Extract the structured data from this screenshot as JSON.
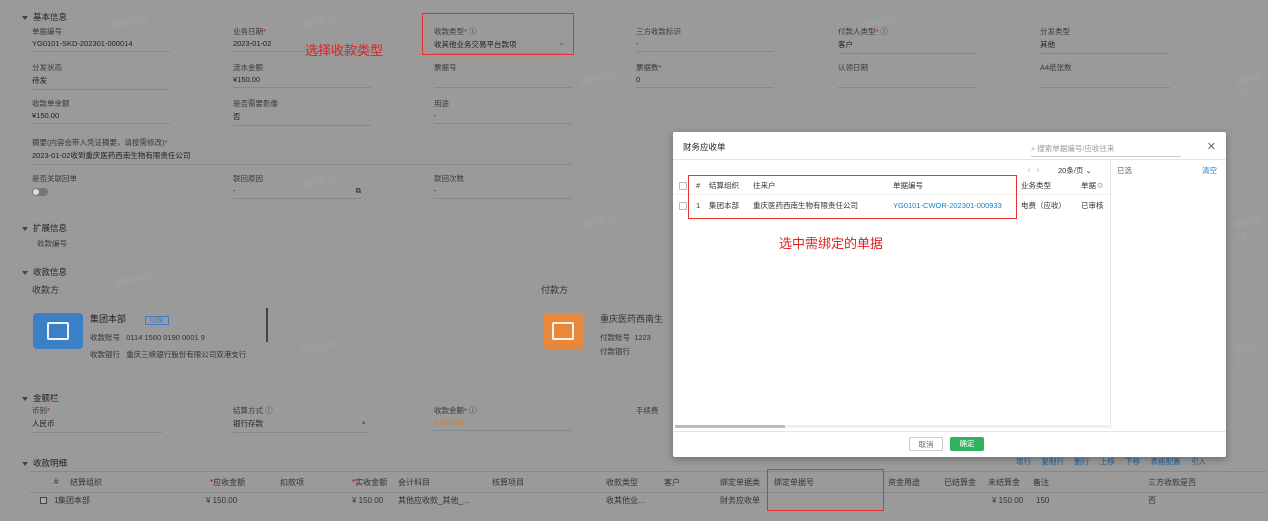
{
  "basic": {
    "title": "基本信息",
    "doc_no": {
      "label": "单据编号",
      "value": "YG0101-SKD-202301-000014"
    },
    "biz_date": {
      "label": "业务日期",
      "value": "2023-01-02"
    },
    "receipt_type": {
      "label": "收款类型",
      "value": "收其他业务交易平台款项"
    },
    "third_party": {
      "label": "三方收款标识",
      "value": "-"
    },
    "payer_type": {
      "label": "付款人类型",
      "value": "客户"
    },
    "dispatch_type": {
      "label": "分发类型",
      "value": "其他"
    },
    "dispatch_status": {
      "label": "分发状态",
      "value": "待发"
    },
    "flow_amount": {
      "label": "流水金额",
      "value": "¥150.00"
    },
    "ticket_no": {
      "label": "票据号",
      "value": ""
    },
    "ticket_count": {
      "label": "票据数",
      "value": "0"
    },
    "recognize_date": {
      "label": "认领日期",
      "value": ""
    },
    "a4_pages": {
      "label": "A4纸张数",
      "value": ""
    },
    "receipt_balance": {
      "label": "收款单余额",
      "value": "¥150.00"
    },
    "need_image": {
      "label": "是否需要影像",
      "value": "否"
    },
    "purpose": {
      "label": "用途",
      "value": "-"
    },
    "summary": {
      "label": "摘要(内容会带入凭证摘要，请按需修改)",
      "value": "2023-01-02收到重庆医药西南生物有限责任公司"
    },
    "is_linked": {
      "label": "是否关联回单"
    },
    "link_reason": {
      "label": "联回原因",
      "value": "-"
    },
    "link_count": {
      "label": "联回次数",
      "value": "-"
    }
  },
  "annot_select_type": "选择收款类型",
  "extend": {
    "title": "扩展信息",
    "field": "收款编号"
  },
  "receipt_info": {
    "title": "收款信息",
    "payee_label": "收款方",
    "payer_label": "付款方",
    "payee": {
      "name": "集团本部",
      "tag": "切换",
      "acct_label": "收款账号",
      "acct": "0114 1560 0190 0001 9",
      "bank_label": "收款银行",
      "bank": "重庆三峡银行股份有限公司双港支行"
    },
    "payer": {
      "name": "重庆医药西南生",
      "acct_label": "付款账号",
      "acct": "1223",
      "bank_label": "付款银行"
    }
  },
  "amount": {
    "title": "金额栏",
    "currency": {
      "label": "币别",
      "value": "人民币"
    },
    "settle": {
      "label": "结算方式",
      "value": "银行存款"
    },
    "receipt_amt": {
      "label": "收款金额",
      "value": "¥ 150.00"
    },
    "fee_label": "手续费"
  },
  "detail": {
    "title": "收款明细",
    "actions": [
      "增行",
      "复制行",
      "删行",
      "上移",
      "下移",
      "表格配置",
      "引入"
    ],
    "cols": [
      "#",
      "结算组织",
      "应收金额",
      "扣款项",
      "实收金额",
      "会计科目",
      "核算项目",
      "收款类型",
      "客户",
      "绑定单据类",
      "绑定单据号",
      "资金用途",
      "已结算金",
      "未结算金",
      "备注",
      "三方收款是否"
    ],
    "row": [
      "1",
      "集团本部",
      "¥ 150.00",
      "",
      "¥ 150.00",
      "其他应收款_其他_...",
      "",
      "收其他业...",
      "",
      "财务应收单",
      "",
      "",
      "",
      "¥ 150.00",
      "150",
      "否"
    ]
  },
  "dialog": {
    "title": "财务应收单",
    "search_placeholder": "搜索单据编号/应收往来",
    "pager": "20条/页",
    "selected": "已选",
    "clear": "清空",
    "cols": [
      "#",
      "结算组织",
      "往来户",
      "单据编号",
      "业务类型",
      "单据"
    ],
    "row": {
      "no": "1",
      "org": "集团本部",
      "party": "重庆医药西南生物有限责任公司",
      "doc": "YG0101-CWOR-202301-000933",
      "biz": "电费（应收）",
      "status": "已审核"
    },
    "cancel": "取消",
    "ok": "确定"
  },
  "annot_select_doc": "选中需绑定的单据",
  "colors": {
    "accent": "#1a7fc1",
    "red": "#e02020",
    "ok": "#2fb35f",
    "bank_blue": "#3d7fc6",
    "bank_orange": "#e8883a"
  }
}
